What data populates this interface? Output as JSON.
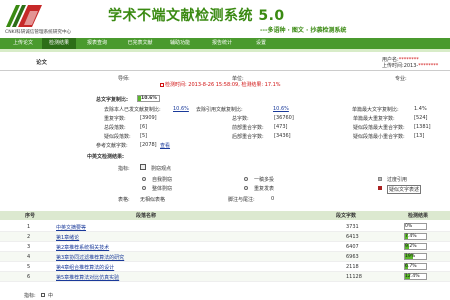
{
  "header": {
    "site_name": "CNKI科研诚信管理系统研究中心",
    "system_title": "学术不端文献检测系统 5.0",
    "slogan": "---多语种 · 图文 · 抄袭检测系统"
  },
  "nav": {
    "items": [
      "上传论文",
      "检测结果",
      "报表查询",
      "已完表文献",
      "辅助功能",
      "报告统计",
      "设置"
    ],
    "active_index": 1
  },
  "user": {
    "name": "用户名:",
    "id_redacted": "********",
    "last_login_label": "上传时间:",
    "last_login_value": "2013-"
  },
  "section_title": "论文",
  "meta": {
    "author_label": "导师:",
    "unit_label": "单位:",
    "major_label": "专业:",
    "check_time": "检测时间: 2013-8-26 15:58:09, 检测结果: 17.1%"
  },
  "summary": {
    "total_label": "总文字复制比:",
    "total_value": "10.6%",
    "exclude_self_label": "去除本人已发文献复制比:",
    "exclude_self_value": "10.6%",
    "exclude_quote_label": "去除引用文献复制比:",
    "exclude_quote_value": "10.6%",
    "max_single_label": "单篇最大文字复制比:",
    "max_single_value": "1.4%",
    "stats": [
      {
        "label": "重复字数:",
        "value": "[3909]"
      },
      {
        "label": "总字数:",
        "value": "[36760]"
      },
      {
        "label": "单篇最大重复字数:",
        "value": "[524]"
      },
      {
        "label": "总段落数:",
        "value": "[6]"
      },
      {
        "label": "前部重合字数:",
        "value": "[473]"
      },
      {
        "label": "疑似段落最大重合字数:",
        "value": "[1381]"
      },
      {
        "label": "疑似段落数:",
        "value": "[5]"
      },
      {
        "label": "后部重合字数:",
        "value": "[3436]"
      },
      {
        "label": "疑似段落最小重合字数:",
        "value": "[13]"
      }
    ],
    "ref_words_label": "参考文献字数:",
    "ref_words_value": "[2078]",
    "ref_link": "查看"
  },
  "full_text_title": "中英文检测结果:",
  "legend": {
    "indicator_label": "指标:",
    "suspect_label": "剽窃观点",
    "items": [
      "自我剽窃",
      "一稿多投",
      "过度引用",
      "整体剽窃",
      "重复发表",
      "疑似文字表述"
    ],
    "item_colors": [
      "#ffffff",
      "#ffffff",
      "#bbbbbb",
      "#ffffff",
      "#ffffff",
      "#aa2222"
    ],
    "table_label": "表格:",
    "table_value": "无相似表格",
    "scripts_label": "脚注与尾注:",
    "scripts_value": "0"
  },
  "table": {
    "headers": [
      "序号",
      "段落名称",
      "段文字数",
      "检测结果"
    ],
    "rows": [
      {
        "no": "1",
        "name": "中英文摘要等",
        "words": "3731",
        "result": "0%",
        "fraction": 0.0
      },
      {
        "no": "2",
        "name": "第1章绪论",
        "words": "6413",
        "result": "7.4%",
        "fraction": 0.074
      },
      {
        "no": "3",
        "name": "第2章推荐系统相关技术",
        "words": "6407",
        "result": "9.2%",
        "fraction": 0.092
      },
      {
        "no": "4",
        "name": "第3章协同过滤推荐算法的研究",
        "words": "6963",
        "result": "19%",
        "fraction": 0.19
      },
      {
        "no": "5",
        "name": "第4章组合推荐算法的设计",
        "words": "2118",
        "result": "6.7%",
        "fraction": 0.067
      },
      {
        "no": "6",
        "name": "第5章推荐算法对比仿真实验",
        "words": "11128",
        "result": "12.4%",
        "fraction": 0.124
      }
    ],
    "footer_label": "指标:",
    "footer_value": "中"
  },
  "colors": {
    "nav_green": "#4a9a2e",
    "title_green": "#3a8a12",
    "bar_green": "#5cb82c",
    "alert_red": "#d01010"
  }
}
